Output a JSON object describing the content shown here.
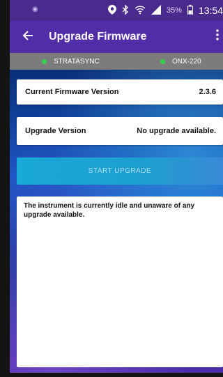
{
  "status_bar": {
    "left_indicator": "◉",
    "battery_percent": "35%",
    "clock": "13:54",
    "icons": [
      "location-icon",
      "bluetooth-icon",
      "wifi-icon",
      "signal-icon",
      "battery-icon"
    ]
  },
  "app_bar": {
    "title": "Upgrade Firmware",
    "back_icon": "back-arrow-icon",
    "menu_icon": "more-vert-icon"
  },
  "connection": {
    "left_name": "STRATASYNC",
    "right_name": "ONX-220",
    "status_color": "#34d44a"
  },
  "firmware": {
    "current_label": "Current Firmware Version",
    "current_value": "2.3.6",
    "upgrade_label": "Upgrade Version",
    "upgrade_value": "No upgrade available."
  },
  "actions": {
    "start_upgrade_label": "START UPGRADE"
  },
  "message": {
    "text": "The instrument is currently idle and unaware of any upgrade available."
  },
  "colors": {
    "app_bar": "#512da8",
    "status_bar": "#4b2a8e",
    "connection_bar": "#7c7c7c",
    "button": "#1aa9d8"
  }
}
